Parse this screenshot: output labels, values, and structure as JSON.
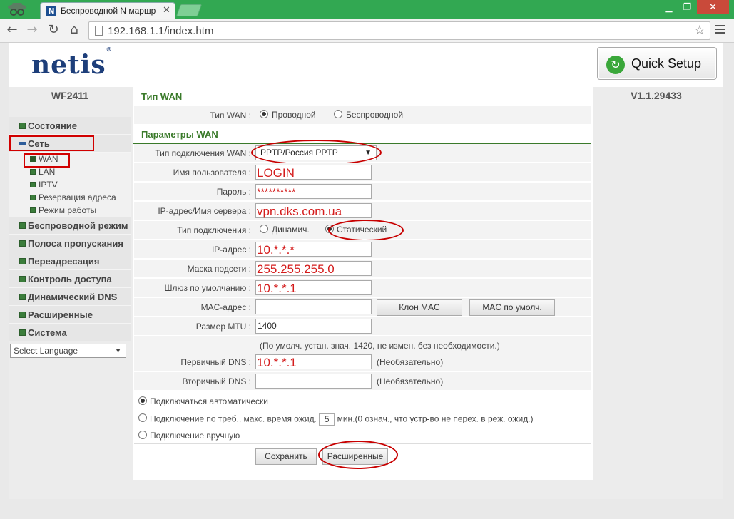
{
  "browser": {
    "tab_title": "Беспроводной N маршр",
    "favicon_letter": "N",
    "url": "192.168.1.1/index.htm"
  },
  "header": {
    "logo": "netis",
    "quick_setup": "Quick Setup"
  },
  "device": {
    "model": "WF2411",
    "version": "V1.1.29433"
  },
  "sidebar": {
    "items": [
      {
        "label": "Состояние"
      },
      {
        "label": "Сеть"
      },
      {
        "label": "Беспроводной режим"
      },
      {
        "label": "Полоса пропускания"
      },
      {
        "label": "Переадресация"
      },
      {
        "label": "Контроль доступа"
      },
      {
        "label": "Динамический DNS"
      },
      {
        "label": "Расширенные"
      },
      {
        "label": "Система"
      }
    ],
    "network_sub": [
      {
        "label": "WAN"
      },
      {
        "label": "LAN"
      },
      {
        "label": "IPTV"
      },
      {
        "label": "Резервация адреса"
      },
      {
        "label": "Режим работы"
      }
    ],
    "language": "Select Language"
  },
  "wan_type": {
    "section_title": "Тип WAN",
    "label": "Тип WAN :",
    "option_wired": "Проводной",
    "option_wireless": "Беспроводной",
    "selected": "Проводной"
  },
  "wan_params": {
    "section_title": "Параметры WAN",
    "connection_type_label": "Тип подключения WAN :",
    "connection_type_value": "PPTP/Россия PPTP",
    "username_label": "Имя пользователя :",
    "username_value": "LOGIN",
    "password_label": "Пароль :",
    "password_value": "**********",
    "server_label": "IP-адрес/Имя сервера :",
    "server_value": "vpn.dks.com.ua",
    "addr_type_label": "Тип подключения :",
    "addr_dynamic": "Динамич.",
    "addr_static": "Статический",
    "addr_selected": "Статический",
    "ip_label": "IP-адрес :",
    "ip_value": "10.*.*.*",
    "mask_label": "Маска подсети :",
    "mask_value": "255.255.255.0",
    "gateway_label": "Шлюз по умолчанию :",
    "gateway_value": "10.*.*.1",
    "mac_label": "MAC-адрес :",
    "mac_value": "",
    "clone_mac": "Клон MAC",
    "default_mac": "MAC по умолч.",
    "mtu_label": "Размер MTU :",
    "mtu_value": "1400",
    "mtu_note": "(По умолч. устан. знач. 1420, не измен. без необходимости.)",
    "dns1_label": "Первичный DNS :",
    "dns1_value": "10.*.*.1",
    "dns1_hint": "(Необязательно)",
    "dns2_label": "Вторичный DNS :",
    "dns2_value": "",
    "dns2_hint": "(Необязательно)"
  },
  "connection_mode": {
    "auto": "Подключаться автоматически",
    "on_demand_prefix": "Подключение по треб., макс. время ожид.",
    "on_demand_value": "5",
    "on_demand_suffix": "мин.(0 означ., что устр-во не перех. в реж. ожид.)",
    "manual": "Подключение вручную",
    "selected": "auto"
  },
  "actions": {
    "save": "Сохранить",
    "advanced": "Расширенные"
  }
}
